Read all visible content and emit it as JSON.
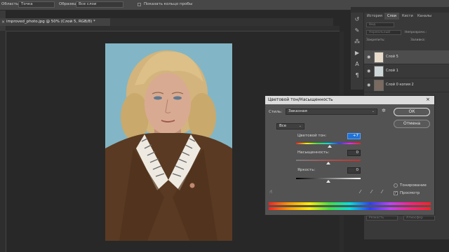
{
  "options_bar": {
    "field1_label": "Область:",
    "field1_value": "Точка",
    "field2_label": "Образец:",
    "field2_value": "Все слои",
    "checkbox_label": "Показать кольцо пробы"
  },
  "document": {
    "tab_title": "improved_photo.jpg @ 50% (Слой 5, RGB/8) *",
    "close_glyph": "×"
  },
  "layers_panel": {
    "tabs": [
      "История",
      "Слои",
      "Кисти",
      "Каналы"
    ],
    "active_tab": "Слои",
    "kind_placeholder": "Вид",
    "blend_mode": "Нормальный",
    "opacity_label": "Непрозрачн.:",
    "lock_label": "Закрепить:",
    "fill_label": "Заливка:",
    "layers": [
      {
        "name": "Слой 5"
      },
      {
        "name": "Слой 1"
      },
      {
        "name": "Слой 0 копия 2"
      }
    ],
    "bottom_field_1": "Резкость",
    "bottom_field_2": "Атмосфер"
  },
  "dialog": {
    "title": "Цветовой тон/Насыщенность",
    "close_glyph": "×",
    "style_label": "Стиль:",
    "style_value": "Заказная",
    "ok_label": "ОК",
    "cancel_label": "Отмена",
    "range_value": "Все",
    "hue_label": "Цветовой тон:",
    "hue_value": "+7",
    "saturation_label": "Насыщенность:",
    "saturation_value": "0",
    "lightness_label": "Яркость:",
    "lightness_value": "0",
    "colorize_label": "Тонирование",
    "preview_label": "Просмотр",
    "preview_checked": true,
    "hue_position": 0.52,
    "saturation_position": 0.5,
    "lightness_position": 0.5
  },
  "colors": {
    "accent": "#1f73d6",
    "photo_background": "#82b6c6",
    "jacket": "#5a3a22"
  },
  "icons": [
    "close-icon",
    "eye-icon",
    "history-icon",
    "brush-icon",
    "play-icon",
    "pipette-icon",
    "pipette-plus-icon",
    "pipette-minus-icon",
    "hand-icon",
    "gear-icon"
  ]
}
